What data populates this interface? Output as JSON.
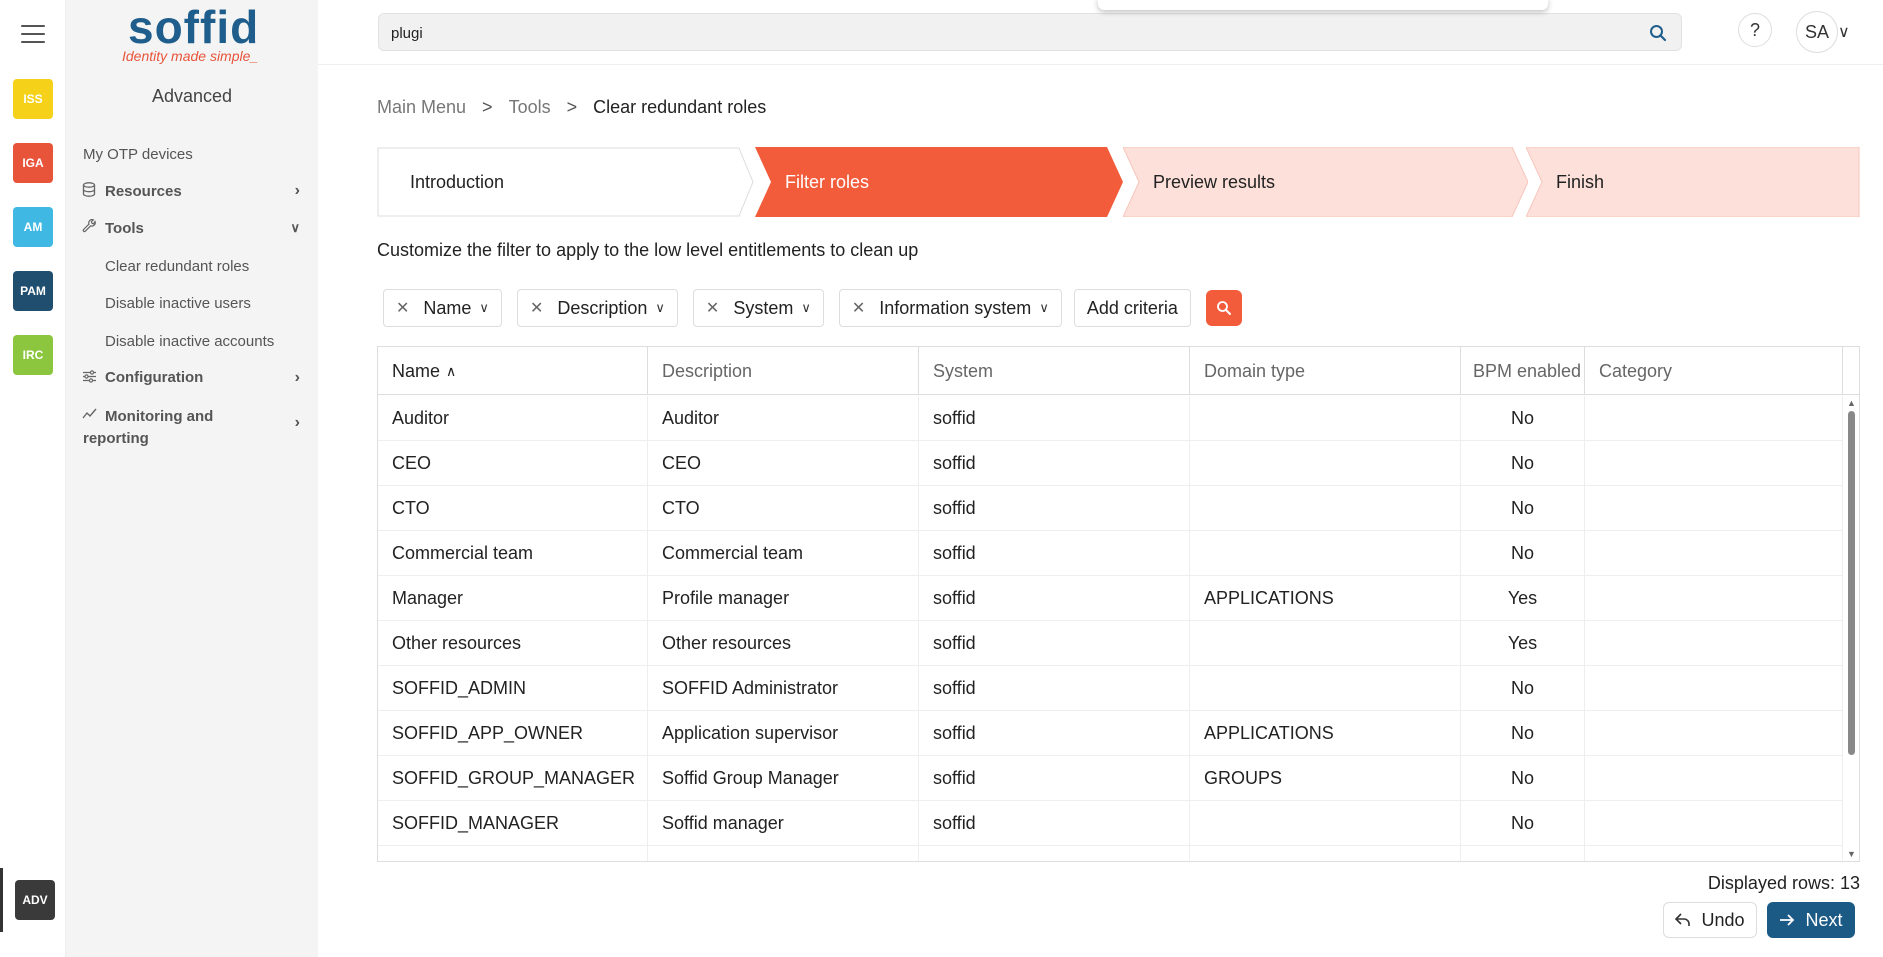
{
  "colors": {
    "brand_blue": "#1f5e8c",
    "brand_orange": "#e8543a",
    "step_active": "#f25c3b",
    "step_pending": "#fde0da",
    "next_button": "#1c5a86"
  },
  "rail": {
    "tiles": [
      {
        "label": "ISS",
        "color": "#f5d219"
      },
      {
        "label": "IGA",
        "color": "#e8543a"
      },
      {
        "label": "AM",
        "color": "#3fb8e3"
      },
      {
        "label": "PAM",
        "color": "#1f4e6e"
      },
      {
        "label": "IRC",
        "color": "#8cc63f"
      }
    ],
    "active_tile": {
      "label": "ADV",
      "color": "#3a3a3a"
    }
  },
  "sidebar": {
    "logo_word": "soffid",
    "logo_tagline": "Identity made simple_",
    "title": "Advanced",
    "items": {
      "otp": "My OTP devices",
      "resources": "Resources",
      "tools": "Tools",
      "tools_sub": [
        "Clear redundant roles",
        "Disable inactive users",
        "Disable inactive accounts"
      ],
      "configuration": "Configuration",
      "monitoring": "Monitoring and reporting"
    }
  },
  "header": {
    "search_value": "plugi",
    "help_label": "?",
    "avatar_initials": "SA"
  },
  "breadcrumb": {
    "items": [
      "Main Menu",
      "Tools",
      "Clear redundant roles"
    ],
    "separator": ">"
  },
  "wizard": {
    "steps": [
      "Introduction",
      "Filter roles",
      "Preview results",
      "Finish"
    ],
    "active_index": 1
  },
  "instruction": "Customize the filter to apply to the low level entitlements to clean up",
  "filters": {
    "chips": [
      "Name",
      "Description",
      "System",
      "Information system"
    ],
    "add_label": "Add criteria"
  },
  "table": {
    "columns": [
      "Name",
      "Description",
      "System",
      "Domain type",
      "BPM enabled",
      "Category"
    ],
    "sort_column": "Name",
    "rows": [
      [
        "Auditor",
        "Auditor",
        "soffid",
        "",
        "No",
        ""
      ],
      [
        "CEO",
        "CEO",
        "soffid",
        "",
        "No",
        ""
      ],
      [
        "CTO",
        "CTO",
        "soffid",
        "",
        "No",
        ""
      ],
      [
        "Commercial team",
        "Commercial team",
        "soffid",
        "",
        "No",
        ""
      ],
      [
        "Manager",
        "Profile manager",
        "soffid",
        "APPLICATIONS",
        "Yes",
        ""
      ],
      [
        "Other resources",
        "Other resources",
        "soffid",
        "",
        "Yes",
        ""
      ],
      [
        "SOFFID_ADMIN",
        "SOFFID Administrator",
        "soffid",
        "",
        "No",
        ""
      ],
      [
        "SOFFID_APP_OWNER",
        "Application supervisor",
        "soffid",
        "APPLICATIONS",
        "No",
        ""
      ],
      [
        "SOFFID_GROUP_MANAGER",
        "Soffid Group Manager",
        "soffid",
        "GROUPS",
        "No",
        ""
      ],
      [
        "SOFFID_MANAGER",
        "Soffid manager",
        "soffid",
        "",
        "No",
        ""
      ]
    ]
  },
  "footer": {
    "rowcount": "Displayed rows: 13",
    "undo_label": "Undo",
    "next_label": "Next"
  }
}
